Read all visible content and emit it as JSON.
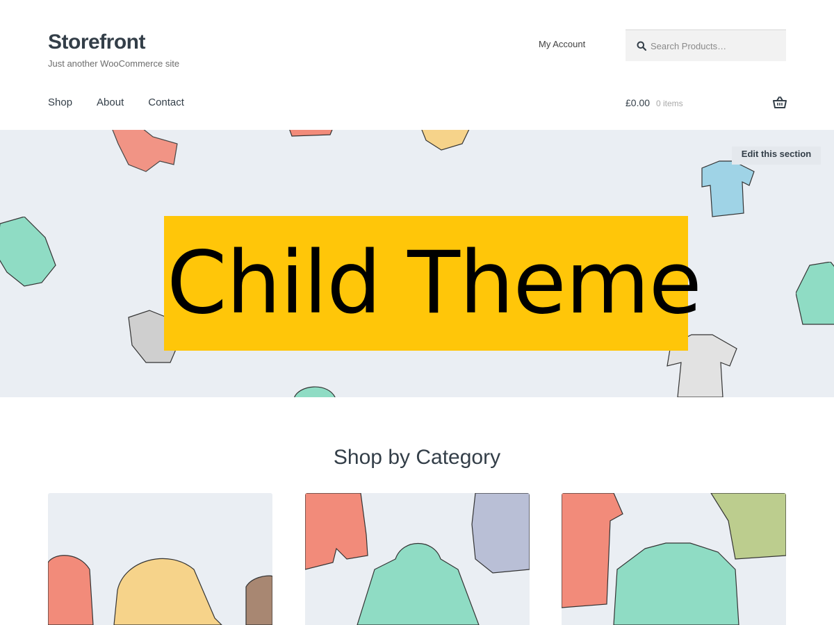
{
  "site": {
    "title": "Storefront",
    "tagline": "Just another WooCommerce site"
  },
  "header": {
    "my_account": "My Account",
    "search_placeholder": "Search Products…"
  },
  "nav": {
    "items": [
      {
        "label": "Shop"
      },
      {
        "label": "About"
      },
      {
        "label": "Contact"
      }
    ]
  },
  "cart": {
    "amount": "£0.00",
    "count": "0 items"
  },
  "hero": {
    "edit_label": "Edit this section",
    "banner_text": "Child Theme"
  },
  "category": {
    "heading": "Shop by Category",
    "cards": [
      {
        "image": "hats-illustration"
      },
      {
        "image": "hoodies-illustration"
      },
      {
        "image": "tshirts-illustration"
      }
    ]
  },
  "colors": {
    "accent_yellow": "#ffc609",
    "hero_bg": "#eaeef3",
    "text": "#333e48",
    "coral": "#f28b7a",
    "mint": "#8fdcc4",
    "sky": "#9fd3e6",
    "mustard": "#f6d38a",
    "olive": "#bccd8e",
    "lavender": "#b9bfd6",
    "grey": "#cfcfcf"
  }
}
